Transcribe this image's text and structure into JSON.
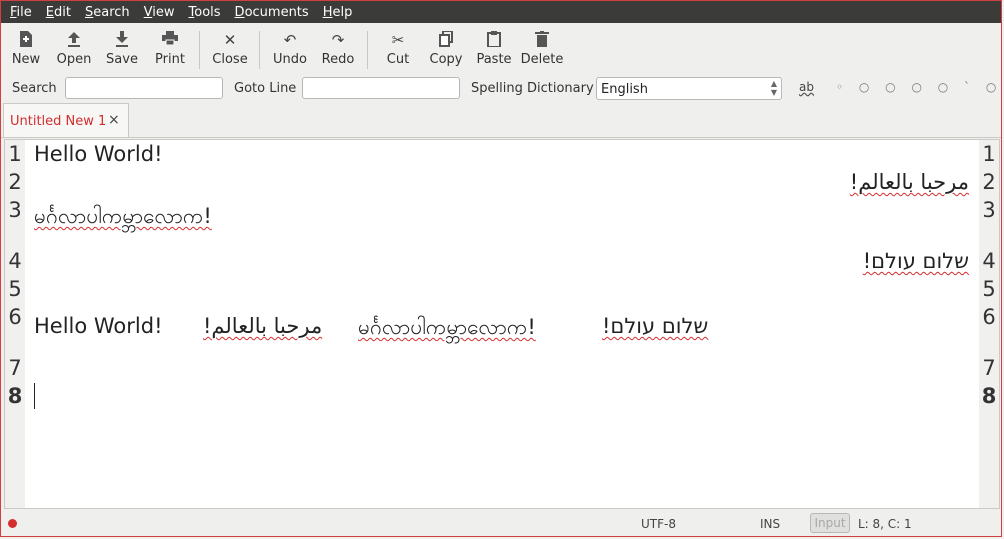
{
  "menu": [
    {
      "accel": "F",
      "rest": "ile"
    },
    {
      "accel": "E",
      "rest": "dit"
    },
    {
      "accel": "S",
      "rest": "earch"
    },
    {
      "accel": "V",
      "rest": "iew"
    },
    {
      "accel": "T",
      "rest": "ools"
    },
    {
      "accel": "D",
      "rest": "ocuments"
    },
    {
      "accel": "H",
      "rest": "elp"
    }
  ],
  "toolbar": {
    "new": "New",
    "open": "Open",
    "save": "Save",
    "print": "Print",
    "close": "Close",
    "undo": "Undo",
    "redo": "Redo",
    "cut": "Cut",
    "copy": "Copy",
    "paste": "Paste",
    "delete": "Delete"
  },
  "icons": {
    "new": "new-document-icon",
    "open": "open-arrow-icon",
    "save": "save-arrow-icon",
    "print": "printer-icon",
    "close": "close-icon",
    "undo": "undo-icon",
    "redo": "redo-icon",
    "cut": "scissors-icon",
    "copy": "copy-icon",
    "paste": "clipboard-icon",
    "delete": "trash-icon"
  },
  "searchbar": {
    "search_label": "Search",
    "search_value": "",
    "goto_label": "Goto Line",
    "goto_value": "",
    "dict_label": "Spelling Dictionary",
    "dict_value": "English",
    "spell_glyph": "ab",
    "extra_glyphs": "◦ ○ ○ ○ ○ ` ○ ~"
  },
  "tab": {
    "title": "Untitled New 1",
    "close": "×"
  },
  "editor": {
    "line_numbers": [
      "1",
      "2",
      "3",
      "4",
      "5",
      "6",
      "7",
      "8"
    ],
    "lines": {
      "l1": "Hello World!",
      "l2": "مرحبا بالعالم!",
      "l3": "မင်္ဂလာပါကမ္ဘာလောက!",
      "l4": "שלום עולם!",
      "l6a": "Hello World!",
      "l6b": "مرحبا بالعالم!",
      "l6c": "မင်္ဂလာပါကမ္ဘာလောက!",
      "l6d": "שלום עולם!"
    }
  },
  "status": {
    "encoding": "UTF-8",
    "mode": "INS",
    "input": "Input",
    "position": "L: 8, C: 1"
  },
  "colors": {
    "accent": "#d42d2d",
    "menubar": "#3b3b39"
  }
}
